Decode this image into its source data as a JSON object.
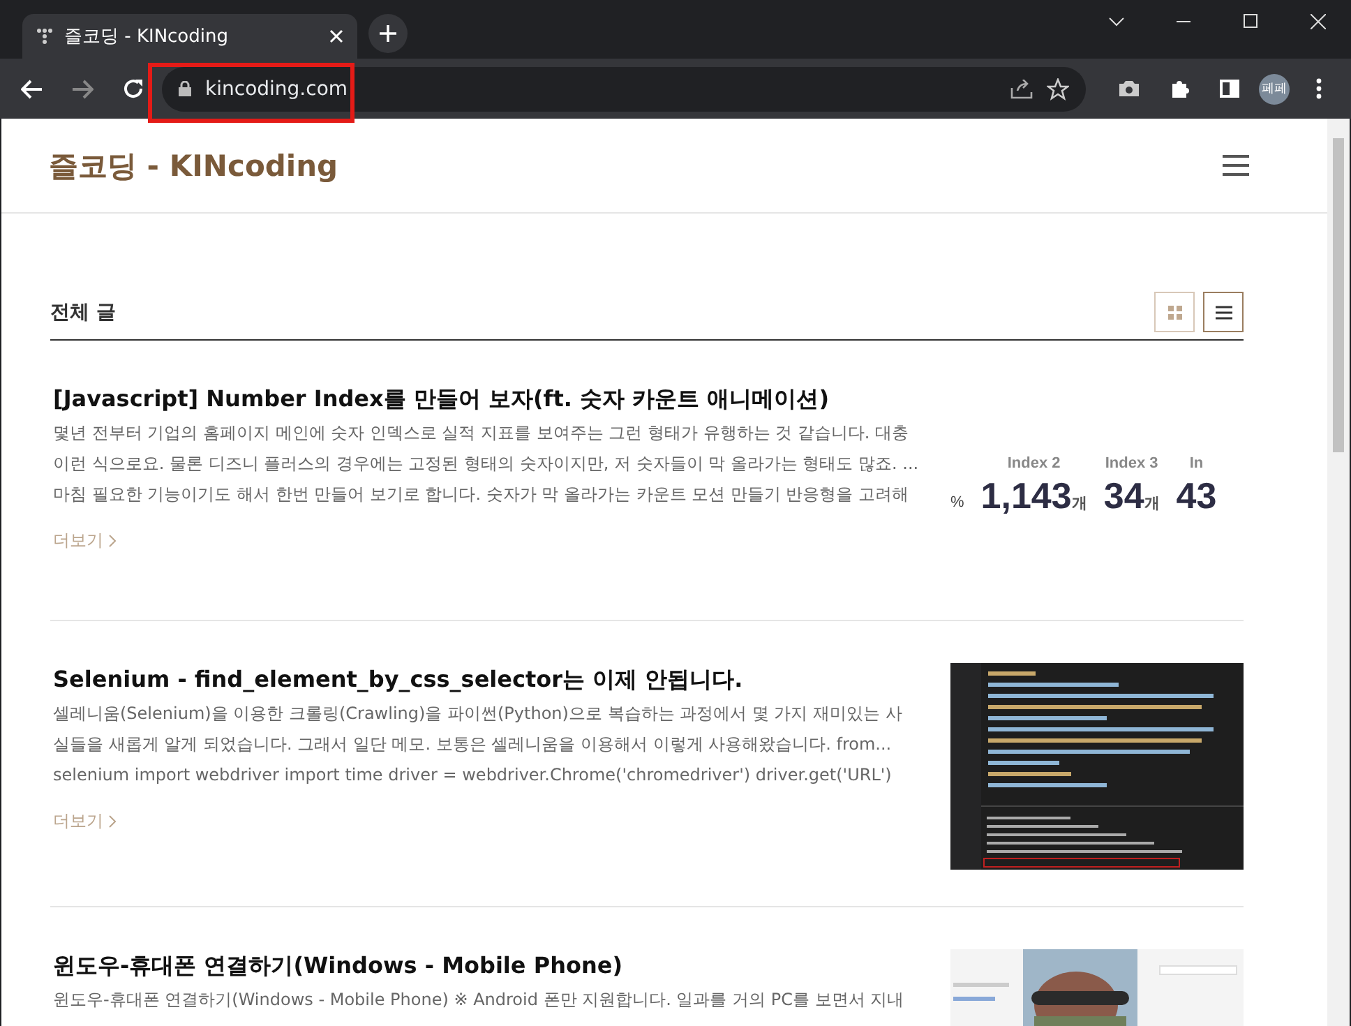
{
  "browser": {
    "tab": {
      "title": "즐코딩 - KINcoding",
      "selected": true
    },
    "url": "kincoding.com",
    "profile": "페페",
    "url_highlighted": true
  },
  "site": {
    "title": "즐코딩 - KINcoding"
  },
  "section": {
    "title": "전체 글",
    "views": [
      {
        "kind": "grid",
        "selected": false
      },
      {
        "kind": "list",
        "selected": true
      }
    ]
  },
  "posts": [
    {
      "title": "[Javascript] Number Index를 만들어 보자(ft. 숫자 카운트 애니메이션)",
      "summary": [
        "몇년 전부터 기업의 홈페이지 메인에 숫자 인덱스로 실적 지표를 보여주는 그런 형태가 유행하는 것 같습니다. 대충",
        "이런 식으로요. 물론 디즈니 플러스의 경우에는 고정된 형태의 숫자이지만, 저 숫자들이 막 올라가는 형태도 많죠. ...",
        "마침 필요한 기능이기도 해서 한번 만들어 보기로 합니다. 숫자가 막 올라가는 카운트 모션 만들기 반응형을 고려해"
      ],
      "more": "더보기",
      "thumbnail": {
        "kind": "stats",
        "prefix": "%",
        "items": [
          {
            "label": "Index 2",
            "value": "1,143",
            "unit": "개"
          },
          {
            "label": "Index 3",
            "value": "34",
            "unit": "개"
          },
          {
            "label": "In",
            "value": "43"
          }
        ]
      }
    },
    {
      "title": "Selenium - find_element_by_css_selector는 이제 안됩니다.",
      "summary": [
        "셀레니움(Selenium)을 이용한 크롤링(Crawling)을 파이썬(Python)으로 복습하는 과정에서 몇 가지 재미있는 사",
        "실들을 새롭게 알게 되었습니다. 그래서 일단 메모. 보통은 셀레니움을 이용해서 이렇게 사용해왔습니다. from...",
        "selenium import webdriver import time driver = webdriver.Chrome('chromedriver') driver.get('URL')"
      ],
      "more": "더보기",
      "thumbnail": {
        "kind": "code"
      }
    },
    {
      "title": "윈도우-휴대폰 연결하기(Windows - Mobile Phone)",
      "summary": [
        "윈도우-휴대폰 연결하기(Windows - Mobile Phone) ※ Android 폰만 지원합니다. 일과를 거의 PC를 보면서 지내"
      ],
      "thumbnail": {
        "kind": "picture"
      }
    }
  ]
}
